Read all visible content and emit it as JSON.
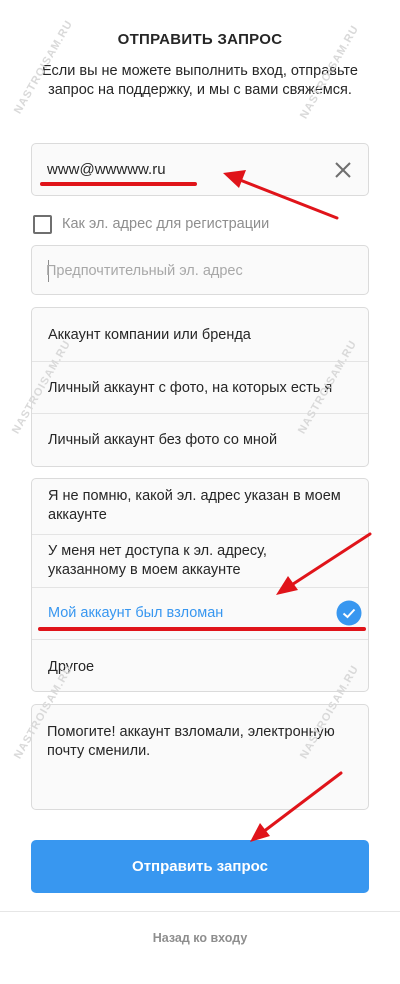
{
  "header": {
    "title": "ОТПРАВИТЬ ЗАПРОС",
    "subtitle": "Если вы не можете выполнить вход, отправьте запрос на поддержку, и мы с вами свяжемся."
  },
  "email_field": {
    "value": "www@wwwww.ru",
    "clear_icon": "close-icon"
  },
  "checkbox": {
    "label": "Как эл. адрес для регистрации",
    "checked": false
  },
  "preferred_email": {
    "placeholder": "Предпочтительный эл. адрес",
    "value": ""
  },
  "account_type_options": [
    {
      "label": "Аккаунт компании или бренда"
    },
    {
      "label": "Личный аккаунт с фото, на которых есть я"
    },
    {
      "label": "Личный аккаунт без фото со мной"
    }
  ],
  "issue_options": [
    {
      "label": "Я не помню, какой эл. адрес указан в моем аккаунте"
    },
    {
      "label": "У меня нет доступа к эл. адресу, указанному в моем аккаунте"
    },
    {
      "label": "Мой аккаунт был взломан",
      "selected": true
    },
    {
      "label": "Другое"
    }
  ],
  "message": {
    "value": "Помогите! аккаунт взломали, электронную почту сменили."
  },
  "submit_button": {
    "label": "Отправить запрос"
  },
  "back_link": {
    "label": "Назад ко входу"
  },
  "watermark": {
    "text": "NASTROISAM.RU"
  },
  "colors": {
    "accent": "#3897f0",
    "annotation_red": "#e0141a",
    "border": "#dbdbdb",
    "muted_text": "#8e8e8e"
  }
}
